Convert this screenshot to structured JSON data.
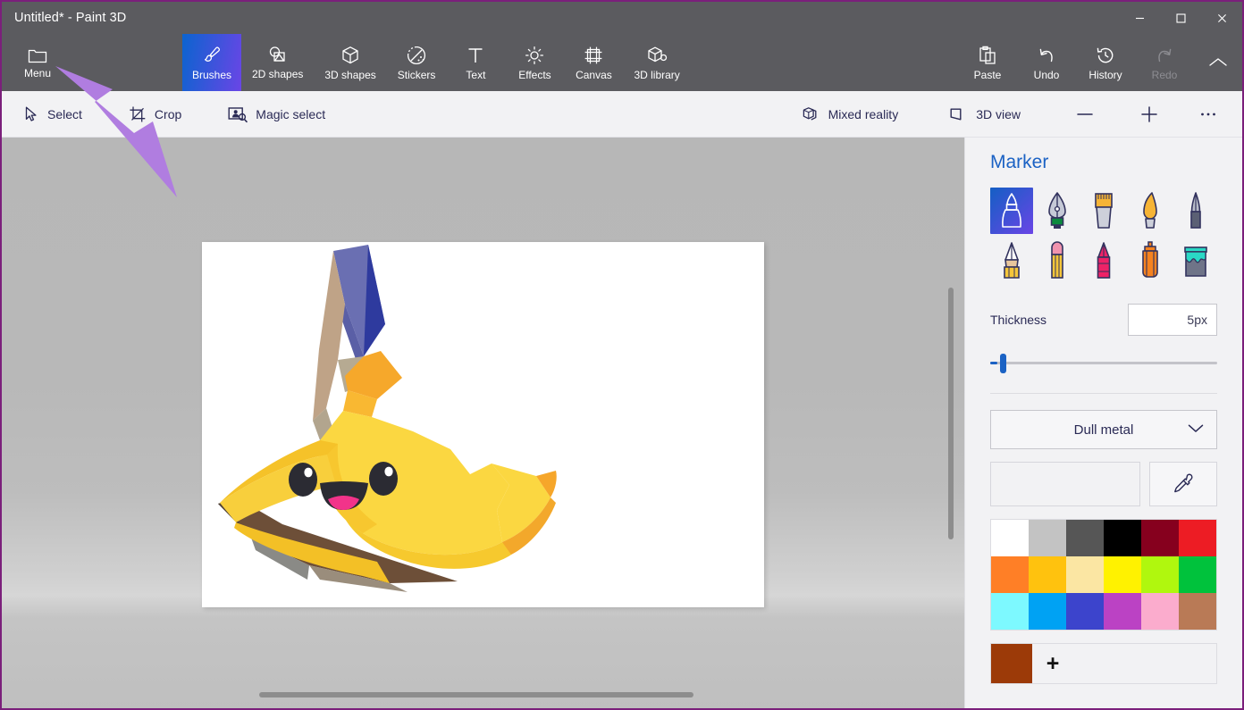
{
  "window": {
    "title": "Untitled* - Paint 3D",
    "controls": [
      {
        "name": "minimize",
        "glyph": "‒"
      },
      {
        "name": "maximize",
        "glyph": "□"
      },
      {
        "name": "close",
        "glyph": "✕"
      }
    ]
  },
  "ribbon": {
    "menu": {
      "label": "Menu",
      "icon": "folder-icon"
    },
    "tools": [
      {
        "label": "Brushes",
        "icon": "paintbrush-icon",
        "active": true,
        "disabled": false
      },
      {
        "label": "2D shapes",
        "icon": "shapes-2d-icon",
        "active": false,
        "disabled": false
      },
      {
        "label": "3D shapes",
        "icon": "cube-icon",
        "active": false,
        "disabled": false
      },
      {
        "label": "Stickers",
        "icon": "sticker-icon",
        "active": false,
        "disabled": false
      },
      {
        "label": "Text",
        "icon": "text-icon",
        "active": false,
        "disabled": false
      },
      {
        "label": "Effects",
        "icon": "brightness-icon",
        "active": false,
        "disabled": false
      },
      {
        "label": "Canvas",
        "icon": "canvas-icon",
        "active": false,
        "disabled": false
      },
      {
        "label": "3D library",
        "icon": "library-3d-icon",
        "active": false,
        "disabled": false
      }
    ],
    "actions": [
      {
        "label": "Paste",
        "icon": "clipboard-icon",
        "disabled": false
      },
      {
        "label": "Undo",
        "icon": "undo-icon",
        "disabled": false
      },
      {
        "label": "History",
        "icon": "history-icon",
        "disabled": false
      },
      {
        "label": "Redo",
        "icon": "redo-icon",
        "disabled": true
      }
    ],
    "collapse": {
      "name": "chevron-up-icon"
    }
  },
  "subbar": {
    "left": [
      {
        "label": "Select",
        "icon": "cursor-arrow-icon"
      },
      {
        "label": "Crop",
        "icon": "crop-icon"
      },
      {
        "label": "Magic select",
        "icon": "magic-select-icon"
      }
    ],
    "right": [
      {
        "label": "Mixed reality",
        "icon": "mixed-reality-icon"
      },
      {
        "label": "3D view",
        "icon": "view-3d-icon"
      }
    ],
    "zoom_out": {
      "label": "Zoom out",
      "icon": "minus-icon"
    },
    "zoom_in": {
      "label": "Zoom in",
      "icon": "plus-icon"
    },
    "more": {
      "label": "More options",
      "icon": "ellipsis-icon"
    }
  },
  "panel": {
    "title": "Marker",
    "brushes": [
      {
        "name": "marker",
        "selected": true
      },
      {
        "name": "calligraphy-pen",
        "selected": false
      },
      {
        "name": "oil-brush",
        "selected": false
      },
      {
        "name": "watercolor-brush",
        "selected": false
      },
      {
        "name": "pixel-pen",
        "selected": false
      },
      {
        "name": "pencil",
        "selected": false
      },
      {
        "name": "eraser",
        "selected": false
      },
      {
        "name": "crayon",
        "selected": false
      },
      {
        "name": "spray-can",
        "selected": false
      },
      {
        "name": "fill-bucket",
        "selected": false
      }
    ],
    "thickness": {
      "label": "Thickness",
      "value": "5px",
      "slider_percent": 3
    },
    "material": {
      "selected": "Dull metal",
      "chevron": "chevron-down-icon"
    },
    "eyedropper": {
      "name": "eyedropper-icon"
    },
    "swatches": [
      "#ffffff",
      "#c3c3c3",
      "#565656",
      "#000000",
      "#86001e",
      "#ed1c24",
      "#ff7f26",
      "#ffc20e",
      "#fbe6a3",
      "#fff200",
      "#b0f70e",
      "#00c23c",
      "#7df9ff",
      "#00a2f3",
      "#3c44cc",
      "#bb42c4",
      "#fbaccd",
      "#b97a56"
    ],
    "custom": {
      "color": "#9c3a08",
      "add_label": "+"
    }
  },
  "workspace": {
    "canvas_background": "#ffffff",
    "model_name": "banana-character-3d"
  },
  "annotation": {
    "arrow_color": "#b07de0",
    "points_to": "Menu"
  }
}
